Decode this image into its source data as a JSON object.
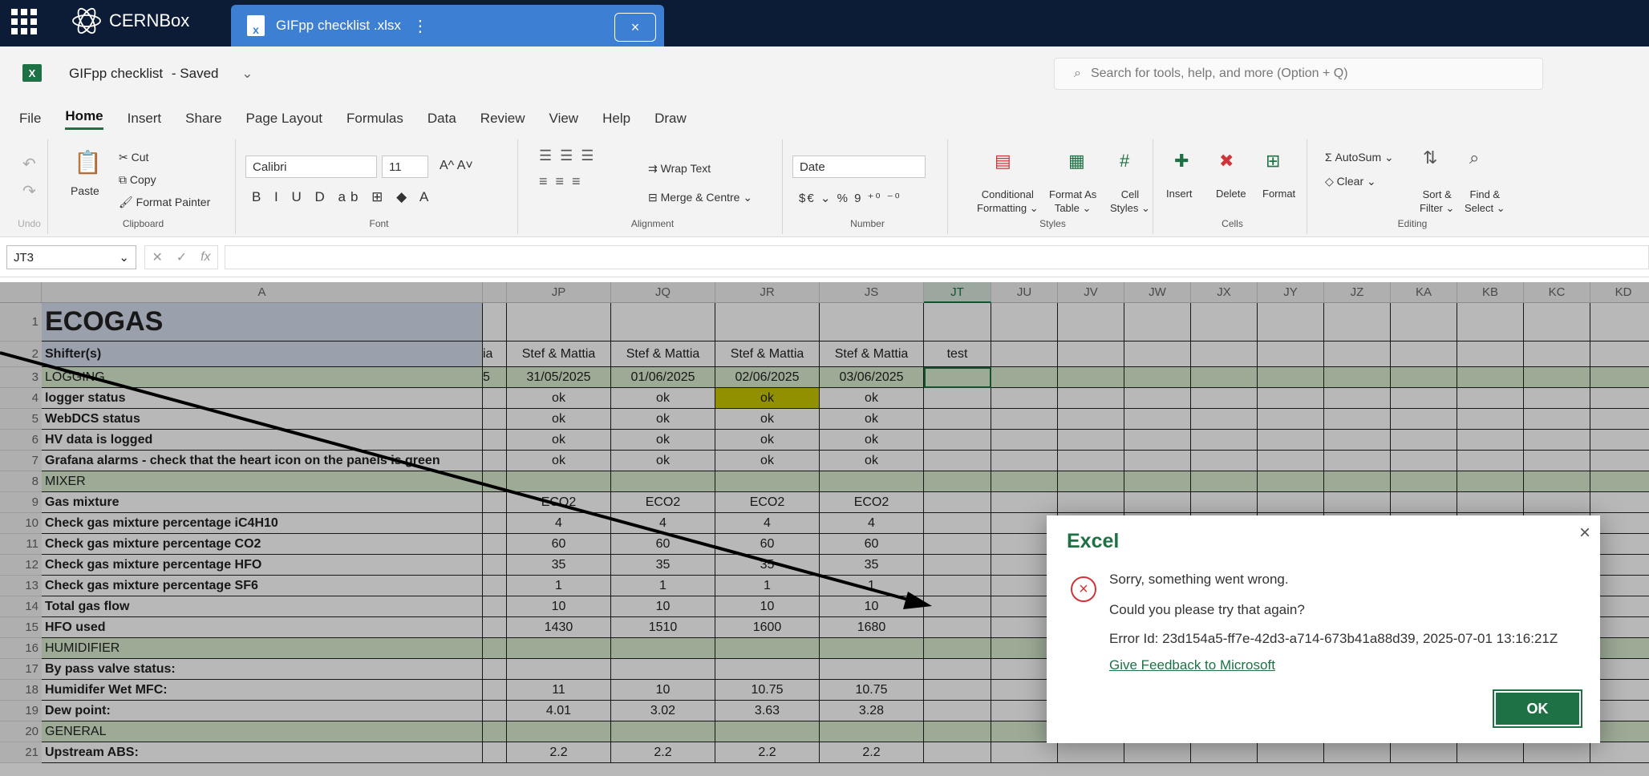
{
  "topbar": {
    "app_name": "CERNBox",
    "tab_title": "GIFpp checklist .xlsx"
  },
  "titlebar": {
    "doc_name": "GIFpp checklist",
    "doc_status": "- Saved",
    "search_placeholder": "Search for tools, help, and more (Option + Q)"
  },
  "menu": [
    "File",
    "Home",
    "Insert",
    "Share",
    "Page Layout",
    "Formulas",
    "Data",
    "Review",
    "View",
    "Help",
    "Draw"
  ],
  "menu_active": "Home",
  "ribbon": {
    "undo_label": "Undo",
    "clipboard": {
      "paste": "Paste",
      "cut": "Cut",
      "copy": "Copy",
      "format_painter": "Format Painter",
      "label": "Clipboard"
    },
    "font": {
      "name": "Calibri",
      "size": "11",
      "label": "Font"
    },
    "alignment": {
      "wrap_text": "Wrap Text",
      "merge_centre": "Merge & Centre",
      "label": "Alignment"
    },
    "number": {
      "format": "Date",
      "currency": "$€",
      "percent": "%",
      "comma": "9",
      "label": "Number"
    },
    "styles": {
      "conditional": "Conditional",
      "formatting": "Formatting",
      "format_as": "Format As",
      "table": "Table",
      "cell": "Cell",
      "cell_styles": "Styles",
      "label": "Styles"
    },
    "cells": {
      "insert": "Insert",
      "delete": "Delete",
      "format": "Format",
      "label": "Cells"
    },
    "editing": {
      "autosum": "AutoSum",
      "clear": "Clear",
      "sort": "Sort &",
      "filter": "Filter",
      "find": "Find &",
      "select": "Select",
      "label": "Editing"
    }
  },
  "formula_bar": {
    "name_box": "JT3",
    "fx": "fx",
    "value": ""
  },
  "columns": [
    "A",
    "JP",
    "JQ",
    "JR",
    "JS",
    "JT",
    "JU",
    "JV",
    "JW",
    "JX",
    "JY",
    "JZ",
    "KA",
    "KB",
    "KC",
    "KD"
  ],
  "partial_col_text": {
    "row2": "ia",
    "row3": "5"
  },
  "rows": [
    {
      "n": "1",
      "a": "ECOGAS",
      "v": [
        "",
        "",
        "",
        "",
        ""
      ]
    },
    {
      "n": "2",
      "a": "Shifter(s)",
      "v": [
        "Stef & Mattia",
        "Stef & Mattia",
        "Stef & Mattia",
        "Stef & Mattia",
        "test"
      ]
    },
    {
      "n": "3",
      "a": "LOGGING",
      "v": [
        "31/05/2025",
        "01/06/2025",
        "02/06/2025",
        "03/06/2025",
        ""
      ]
    },
    {
      "n": "4",
      "a": "logger status",
      "v": [
        "ok",
        "ok",
        "ok",
        "ok",
        ""
      ]
    },
    {
      "n": "5",
      "a": "WebDCS status",
      "v": [
        "ok",
        "ok",
        "ok",
        "ok",
        ""
      ]
    },
    {
      "n": "6",
      "a": "HV data is logged",
      "v": [
        "ok",
        "ok",
        "ok",
        "ok",
        ""
      ]
    },
    {
      "n": "7",
      "a": "Grafana alarms - check that the heart icon on the panels is green",
      "v": [
        "ok",
        "ok",
        "ok",
        "ok",
        ""
      ]
    },
    {
      "n": "8",
      "a": "MIXER",
      "v": [
        "",
        "",
        "",
        "",
        ""
      ]
    },
    {
      "n": "9",
      "a": "Gas mixture",
      "v": [
        "ECO2",
        "ECO2",
        "ECO2",
        "ECO2",
        ""
      ]
    },
    {
      "n": "10",
      "a": "Check gas mixture percentage iC4H10",
      "v": [
        "4",
        "4",
        "4",
        "4",
        ""
      ]
    },
    {
      "n": "11",
      "a": "Check gas mixture percentage  CO2",
      "v": [
        "60",
        "60",
        "60",
        "60",
        ""
      ]
    },
    {
      "n": "12",
      "a": "Check gas mixture percentage HFO",
      "v": [
        "35",
        "35",
        "35",
        "35",
        ""
      ]
    },
    {
      "n": "13",
      "a": "Check gas mixture percentage SF6",
      "v": [
        "1",
        "1",
        "1",
        "1",
        ""
      ]
    },
    {
      "n": "14",
      "a": "Total gas flow",
      "v": [
        "10",
        "10",
        "10",
        "10",
        ""
      ]
    },
    {
      "n": "15",
      "a": "HFO used",
      "v": [
        "1430",
        "1510",
        "1600",
        "1680",
        ""
      ]
    },
    {
      "n": "16",
      "a": "HUMIDIFIER",
      "v": [
        "",
        "",
        "",
        "",
        ""
      ]
    },
    {
      "n": "17",
      "a": "By pass valve status:",
      "v": [
        "",
        "",
        "",
        "",
        ""
      ]
    },
    {
      "n": "18",
      "a": "Humidifer Wet MFC:",
      "v": [
        "11",
        "10",
        "10.75",
        "10.75",
        ""
      ]
    },
    {
      "n": "19",
      "a": "Dew point:",
      "v": [
        "4.01",
        "3.02",
        "3.63",
        "3.28",
        ""
      ]
    },
    {
      "n": "20",
      "a": "GENERAL",
      "v": [
        "",
        "",
        "",
        "",
        ""
      ]
    },
    {
      "n": "21",
      "a": "Upstream ABS:",
      "v": [
        "2.2",
        "2.2",
        "2.2",
        "2.2",
        ""
      ]
    }
  ],
  "section_rows": [
    "3",
    "8",
    "16",
    "20"
  ],
  "dialog": {
    "title": "Excel",
    "message": "Sorry, something went wrong.",
    "retry": "Could you please try that again?",
    "error_id": "Error Id: 23d154a5-ff7e-42d3-a714-673b41a88d39, 2025-07-01 13:16:21Z",
    "feedback_link": "Give Feedback to Microsoft",
    "ok": "OK"
  },
  "colors": {
    "brand_green": "#1e7145",
    "topbar": "#0c1b36",
    "tab_blue": "#3d7fd2",
    "error_red": "#d13438",
    "highlight_yellow": "#c8c800"
  }
}
